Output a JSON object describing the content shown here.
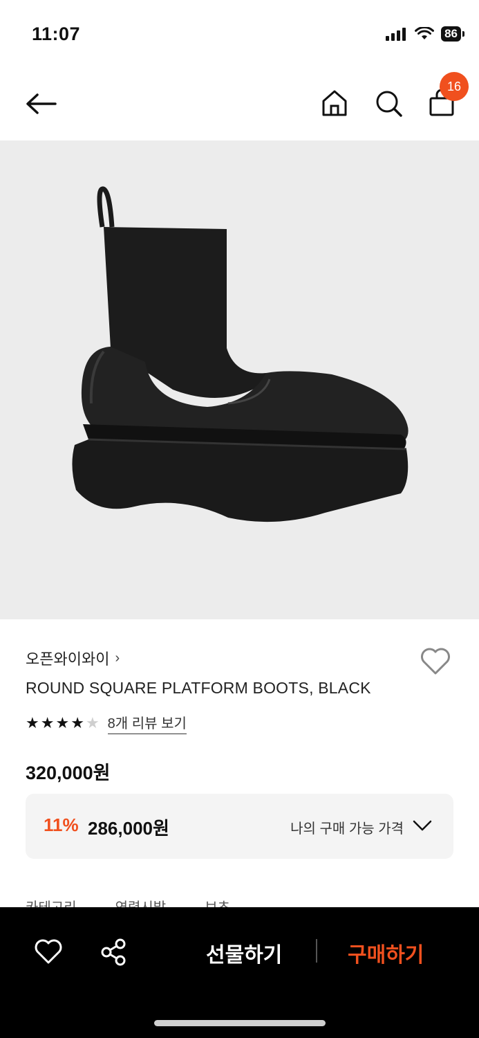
{
  "status": {
    "time": "11:07",
    "battery": "86"
  },
  "nav": {
    "cart_count": "16"
  },
  "product": {
    "brand": "오픈와이와이",
    "name": "ROUND SQUARE PLATFORM BOOTS, BLACK",
    "rating": 4,
    "rating_max": 5,
    "review_link": "8개 리뷰 보기",
    "price": "320,000원",
    "discount": {
      "percent": "11%",
      "price": "286,000원",
      "label": "나의 구매 가능 가격"
    }
  },
  "tabs_partial": [
    "카테고리",
    "연령시발",
    "브초"
  ],
  "bottom": {
    "gift_label": "선물하기",
    "buy_label": "구매하기"
  },
  "colors": {
    "accent": "#f0501e",
    "bottom_bar": "#000000",
    "image_bg": "#ececec"
  },
  "icons": [
    "back-arrow-icon",
    "home-icon",
    "search-icon",
    "shopping-bag-icon",
    "heart-icon",
    "share-icon",
    "chevron-down-icon",
    "star-icon"
  ]
}
